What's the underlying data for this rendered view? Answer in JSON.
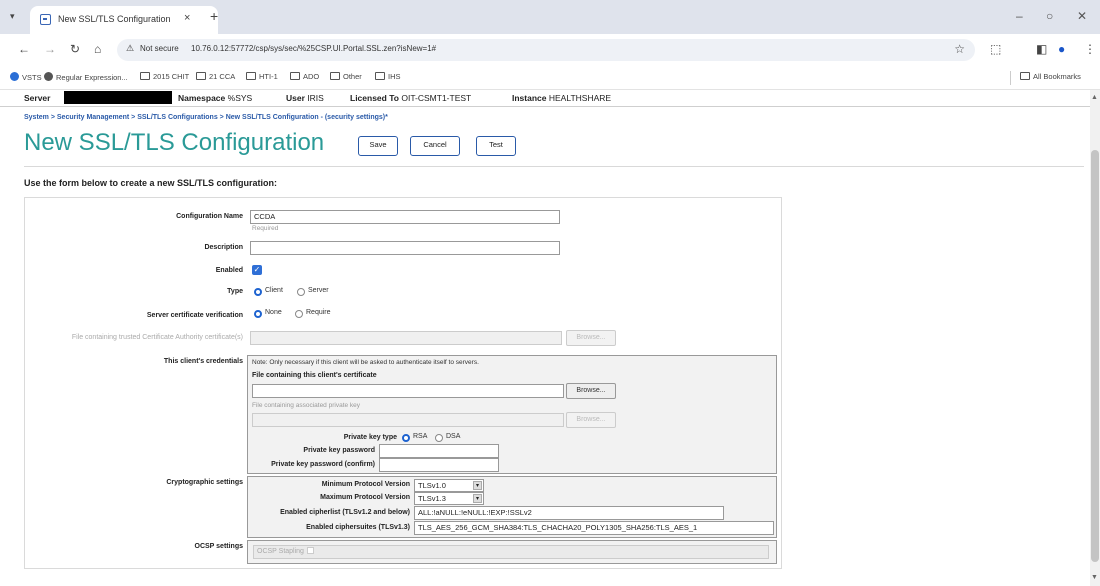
{
  "browser": {
    "tab_title": "New SSL/TLS Configuration",
    "tab_close": "×",
    "new_tab": "+",
    "not_secure": "Not secure",
    "url": "10.76.0.12:57772/csp/sys/sec/%25CSP.UI.Portal.SSL.zen?isNew=1#",
    "window_minimize": "–",
    "window_restore": "○",
    "window_close": "✕",
    "bookmarks": [
      "VSTS",
      "Regular Expression...",
      "2015 CHIT",
      "21 CCA",
      "HTI-1",
      "ADO",
      "Other",
      "IHS"
    ],
    "all_bookmarks": "All Bookmarks",
    "icons": {
      "tab_menu": "chevron-down-icon",
      "favicon": "page-icon",
      "back": "back-arrow-icon",
      "forward": "forward-arrow-icon",
      "reload": "reload-icon",
      "home": "home-icon",
      "warning": "warning-triangle-icon",
      "star": "star-icon",
      "extensions": "puzzle-icon",
      "sidepanel": "sidepanel-icon",
      "profile": "profile-icon",
      "menu": "kebab-menu-icon"
    }
  },
  "header": {
    "server_label": "Server",
    "namespace_label": "Namespace",
    "namespace_value": "%SYS",
    "user_label": "User",
    "user_value": "IRIS",
    "licensed_label": "Licensed To",
    "licensed_value": "OIT-CSMT1-TEST",
    "instance_label": "Instance",
    "instance_value": "HEALTHSHARE"
  },
  "breadcrumb": "System > Security Management > SSL/TLS Configurations > New SSL/TLS Configuration  - (security settings)*",
  "page_title": "New SSL/TLS Configuration",
  "buttons": {
    "save": "Save",
    "cancel": "Cancel",
    "test": "Test"
  },
  "instructions": "Use the form below to create a new SSL/TLS configuration:",
  "form": {
    "config_name_label": "Configuration Name",
    "config_name_value": "CCDA",
    "required_hint": "Required",
    "description_label": "Description",
    "description_value": "",
    "enabled_label": "Enabled",
    "enabled_checked": true,
    "type_label": "Type",
    "type_options": [
      "Client",
      "Server"
    ],
    "type_selected": "Client",
    "verification_label": "Server certificate verification",
    "verification_options": [
      "None",
      "Require"
    ],
    "verification_selected": "None",
    "ca_file_label": "File containing trusted Certificate Authority certificate(s)",
    "browse_label": "Browse...",
    "credentials_label": "This client's credentials",
    "credentials_note": "Note: Only necessary if this client will be asked to authenticate itself to servers.",
    "client_cert_label": "File containing this client's certificate",
    "private_key_file_label": "File containing associated private key",
    "private_key_type_label": "Private key type",
    "key_type_options": [
      "RSA",
      "DSA"
    ],
    "key_type_selected": "RSA",
    "private_key_password_label": "Private key password",
    "private_key_password_confirm_label": "Private key password (confirm)",
    "crypto_label": "Cryptographic settings",
    "min_protocol_label": "Minimum Protocol Version",
    "min_protocol_value": "TLSv1.0",
    "max_protocol_label": "Maximum Protocol Version",
    "max_protocol_value": "TLSv1.3",
    "cipherlist_label": "Enabled cipherlist (TLSv1.2 and below)",
    "cipherlist_value": "ALL:!aNULL:!eNULL:!EXP:!SSLv2",
    "ciphersuites_label": "Enabled ciphersuites (TLSv1.3)",
    "ciphersuites_value": "TLS_AES_256_GCM_SHA384:TLS_CHACHA20_POLY1305_SHA256:TLS_AES_1",
    "ocsp_label": "OCSP settings",
    "ocsp_stapling_label": "OCSP Stapling"
  }
}
